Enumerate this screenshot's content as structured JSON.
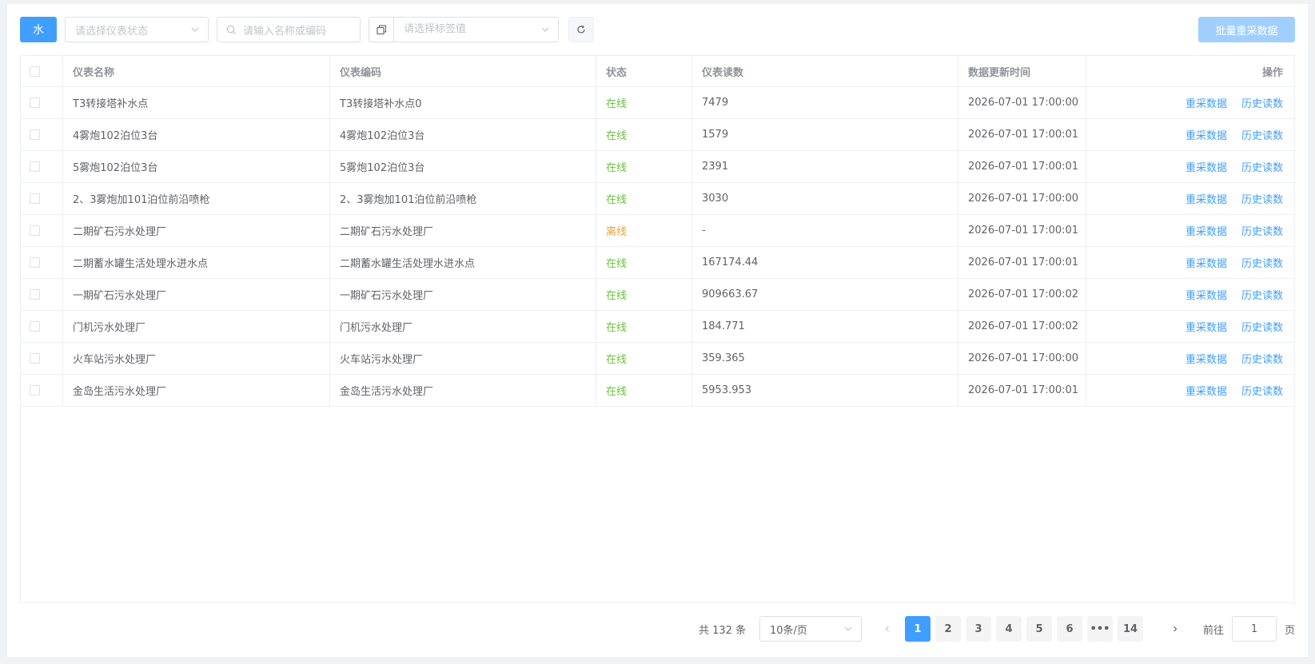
{
  "toolbar": {
    "water_label": "水",
    "status_placeholder": "请选择仪表状态",
    "search_placeholder": "请输入名称或编码",
    "tag_placeholder": "请选择标签值",
    "batch_label": "批量重采数据"
  },
  "table": {
    "headers": {
      "name": "仪表名称",
      "code": "仪表编码",
      "status": "状态",
      "reading": "仪表读数",
      "time": "数据更新时间",
      "ops": "操作"
    },
    "rows": [
      {
        "name": "T3转接塔补水点",
        "code": "T3转接塔补水点0",
        "status": "在线",
        "reading": "7479",
        "time": "2026-07-01 17:00:00",
        "op1": "重采数据",
        "op2": "历史读数"
      },
      {
        "name": "4雾炮102泊位3台",
        "code": "4雾炮102泊位3台",
        "status": "在线",
        "reading": "1579",
        "time": "2026-07-01 17:00:01",
        "op1": "重采数据",
        "op2": "历史读数"
      },
      {
        "name": "5雾炮102泊位3台",
        "code": "5雾炮102泊位3台",
        "status": "在线",
        "reading": "2391",
        "time": "2026-07-01 17:00:01",
        "op1": "重采数据",
        "op2": "历史读数"
      },
      {
        "name": "2、3雾炮加101泊位前沿喷枪",
        "code": "2、3雾炮加101泊位前沿喷枪",
        "status": "在线",
        "reading": "3030",
        "time": "2026-07-01 17:00:00",
        "op1": "重采数据",
        "op2": "历史读数"
      },
      {
        "name": "二期矿石污水处理厂",
        "code": "二期矿石污水处理厂",
        "status": "离线",
        "reading": "-",
        "time": "2026-07-01 17:00:01",
        "op1": "重采数据",
        "op2": "历史读数"
      },
      {
        "name": "二期蓄水罐生活处理水进水点",
        "code": "二期蓄水罐生活处理水进水点",
        "status": "在线",
        "reading": "167174.44",
        "time": "2026-07-01 17:00:01",
        "op1": "重采数据",
        "op2": "历史读数"
      },
      {
        "name": "一期矿石污水处理厂",
        "code": "一期矿石污水处理厂",
        "status": "在线",
        "reading": "909663.67",
        "time": "2026-07-01 17:00:02",
        "op1": "重采数据",
        "op2": "历史读数"
      },
      {
        "name": "门机污水处理厂",
        "code": "门机污水处理厂",
        "status": "在线",
        "reading": "184.771",
        "time": "2026-07-01 17:00:02",
        "op1": "重采数据",
        "op2": "历史读数"
      },
      {
        "name": "火车站污水处理厂",
        "code": "火车站污水处理厂",
        "status": "在线",
        "reading": "359.365",
        "time": "2026-07-01 17:00:00",
        "op1": "重采数据",
        "op2": "历史读数"
      },
      {
        "name": "金岛生活污水处理厂",
        "code": "金岛生活污水处理厂",
        "status": "在线",
        "reading": "5953.953",
        "time": "2026-07-01 17:00:01",
        "op1": "重采数据",
        "op2": "历史读数"
      }
    ]
  },
  "pagination": {
    "total_text": "共 132 条",
    "page_size": "10条/页",
    "pages": [
      "1",
      "2",
      "3",
      "4",
      "5",
      "6",
      "•••",
      "14"
    ],
    "current_page": "1",
    "goto_label": "前往",
    "goto_value": "1",
    "goto_suffix": "页"
  },
  "colors": {
    "primary": "#409eff",
    "online": "#67c23a",
    "offline": "#e6a23c",
    "disabled_primary": "#a0cfff"
  }
}
